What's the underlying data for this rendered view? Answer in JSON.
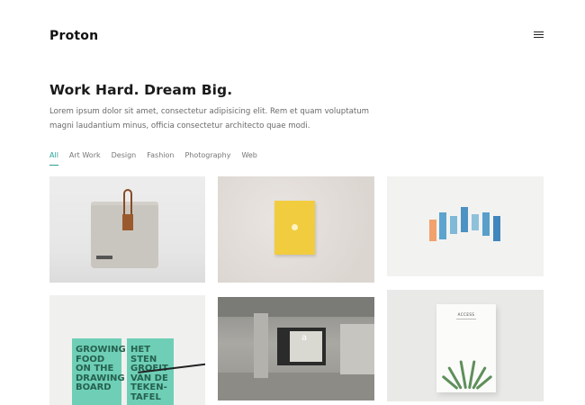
{
  "header": {
    "brand": "Proton",
    "menu_icon": "hamburger-menu-icon"
  },
  "hero": {
    "title": "Work Hard. Dream Big.",
    "text": "Lorem ipsum dolor sit amet, consectetur adipisicing elit. Rem et quam voluptatum magni laudantium minus, officia consectetur architecto quae modi."
  },
  "filters": [
    {
      "label": "All",
      "active": true
    },
    {
      "label": "Art Work",
      "active": false
    },
    {
      "label": "Design",
      "active": false
    },
    {
      "label": "Fashion",
      "active": false
    },
    {
      "label": "Photography",
      "active": false
    },
    {
      "label": "Web",
      "active": false
    }
  ],
  "portfolio": {
    "items": [
      {
        "subject": "canvas-bag"
      },
      {
        "subject": "yellow-book"
      },
      {
        "subject": "color-bars"
      },
      {
        "subject": "green-books",
        "left_text": "GROWING FOOD ON THE DRAWING BOARD",
        "right_text": "HET STEN GROEIT VAN DE TEKEN- TAFEL"
      },
      {
        "subject": "architecture",
        "sign_text": "a"
      },
      {
        "subject": "magazine",
        "cover_text": "ACCESS"
      }
    ]
  },
  "colors": {
    "accent": "#2aa196",
    "text_muted": "#6a6a6a"
  }
}
